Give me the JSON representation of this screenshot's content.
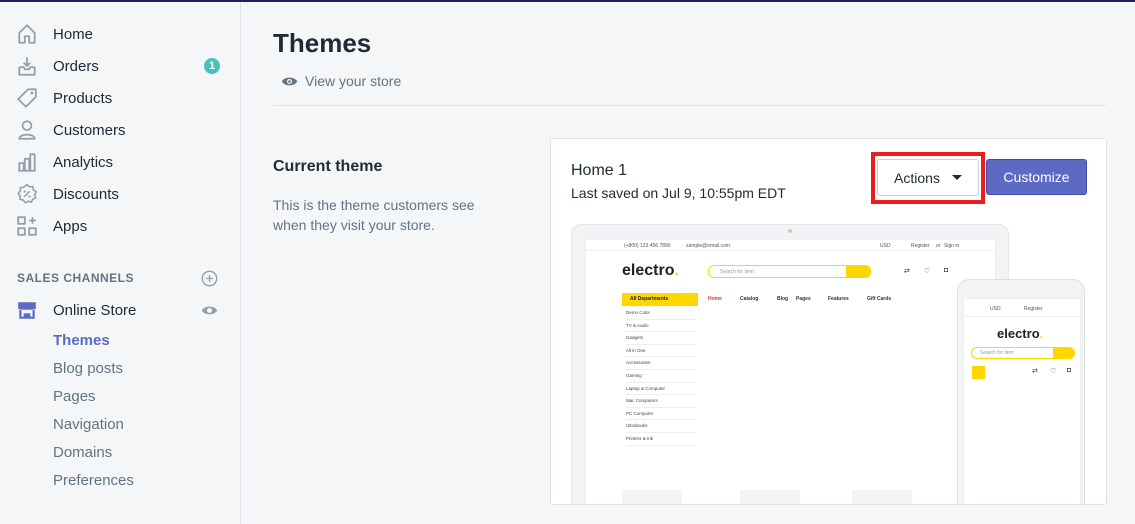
{
  "sidebar": {
    "items": [
      {
        "label": "Home",
        "icon": "home-icon"
      },
      {
        "label": "Orders",
        "icon": "orders-icon",
        "badge": "1"
      },
      {
        "label": "Products",
        "icon": "tag-icon"
      },
      {
        "label": "Customers",
        "icon": "person-icon"
      },
      {
        "label": "Analytics",
        "icon": "bar-chart-icon"
      },
      {
        "label": "Discounts",
        "icon": "discount-icon"
      },
      {
        "label": "Apps",
        "icon": "apps-icon"
      }
    ],
    "sales_channels_title": "SALES CHANNELS",
    "online_store": "Online Store",
    "sub_items": [
      "Themes",
      "Blog posts",
      "Pages",
      "Navigation",
      "Domains",
      "Preferences"
    ]
  },
  "main": {
    "title": "Themes",
    "view_store": "View your store",
    "current_theme_heading": "Current theme",
    "current_theme_desc": "This is the theme customers see when they visit your store.",
    "card": {
      "theme_name": "Home 1",
      "last_saved": "Last saved on Jul 9, 10:55pm EDT",
      "actions_label": "Actions",
      "customize_label": "Customize"
    }
  },
  "preview": {
    "phone_text": "(+800) 123 456 7890",
    "email": "sample@email.com",
    "currency": "USD",
    "register": "Register",
    "or": "or",
    "signin": "Sign in",
    "logo": "electro",
    "search_placeholder": "Search for item",
    "all_departments": "All Departments",
    "nav": [
      "Home",
      "Catalog",
      "Blog",
      "Pages",
      "Features",
      "Gift Cards"
    ],
    "departments": [
      "Demo Color",
      "TV & Audio",
      "Gadgets",
      "All in One",
      "Accessories",
      "Gaming",
      "Laptop & Computer",
      "Mac Computers",
      "PC Computer",
      "Ultrabooks",
      "Printers & Ink"
    ]
  },
  "colors": {
    "accent": "#5c6ac4",
    "badge": "#47c1bf",
    "highlight": "#ef1c1c",
    "preview_yellow": "#fed700"
  }
}
